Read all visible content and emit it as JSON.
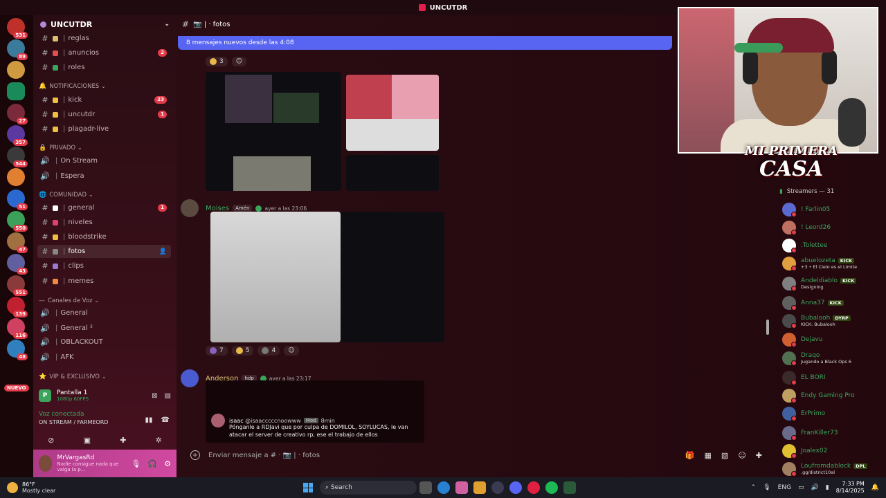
{
  "window": {
    "title": "UNCUTDR"
  },
  "rail": {
    "servers": [
      {
        "badge": "531",
        "color": "#c0302a"
      },
      {
        "badge": "89",
        "color": "#3a7a9a"
      },
      {
        "badge": "",
        "color": "#d09a40"
      },
      {
        "badge": "",
        "color": "#1a8a5a"
      },
      {
        "badge": "27",
        "color": "#7a2a3a"
      },
      {
        "badge": "357",
        "color": "#5a3aa0"
      },
      {
        "badge": "544",
        "color": "#3a3a3a"
      },
      {
        "badge": "",
        "color": "#e08030"
      },
      {
        "badge": "51",
        "color": "#2a6ad0"
      },
      {
        "badge": "550",
        "color": "#3aa05a"
      },
      {
        "badge": "47",
        "color": "#a07040"
      },
      {
        "badge": "43",
        "color": "#6060a0"
      },
      {
        "badge": "551",
        "color": "#8a3a3a"
      },
      {
        "badge": "139",
        "color": "#c02030"
      },
      {
        "badge": "116",
        "color": "#d04060"
      },
      {
        "badge": "48",
        "color": "#3080c0"
      }
    ],
    "nuevo": "NUEVO"
  },
  "sidebar": {
    "server_name": "UNCUTDR",
    "channels": [
      {
        "name": "reglas",
        "type": "text",
        "pip": "#d8c070",
        "count": ""
      },
      {
        "name": "anuncios",
        "type": "text",
        "pip": "#e05050",
        "count": "2"
      },
      {
        "name": "roles",
        "type": "text",
        "pip": "#3ba55c",
        "count": ""
      },
      {
        "name": "kick",
        "type": "text",
        "pip": "#f0c040",
        "count": "23"
      },
      {
        "name": "uncutdr",
        "type": "text",
        "pip": "#f0c040",
        "count": "1"
      },
      {
        "name": "plagadr-live",
        "type": "text",
        "pip": "#f0c040",
        "count": ""
      },
      {
        "name": "On Stream",
        "type": "voice",
        "pip": "",
        "count": ""
      },
      {
        "name": "Espera",
        "type": "voice",
        "pip": "",
        "count": ""
      },
      {
        "name": "general",
        "type": "text",
        "pip": "#ffffff",
        "count": "1"
      },
      {
        "name": "niveles",
        "type": "text",
        "pip": "#e04070",
        "count": ""
      },
      {
        "name": "bloodstrike",
        "type": "text",
        "pip": "#f0c040",
        "count": ""
      },
      {
        "name": "fotos",
        "type": "text",
        "pip": "#888888",
        "count": "",
        "active": true
      },
      {
        "name": "clips",
        "type": "text",
        "pip": "#9a7ad0",
        "count": ""
      },
      {
        "name": "memes",
        "type": "text",
        "pip": "#f08a40",
        "count": ""
      },
      {
        "name": "General",
        "type": "voice",
        "pip": "",
        "count": ""
      },
      {
        "name": "General ²",
        "type": "voice",
        "pip": "",
        "count": ""
      },
      {
        "name": "OBLACKOUT",
        "type": "voice",
        "pip": "",
        "count": ""
      },
      {
        "name": "AFK",
        "type": "voice",
        "pip": "",
        "count": ""
      }
    ],
    "categories": {
      "notificaciones": "NOTIFICACIONES",
      "privado": "PRIVADO",
      "comunidad": "COMUNIDAD",
      "canales_voz": "Canales de Voz",
      "vip": "VIP & EXCLUSIVO"
    },
    "stream_panel": {
      "title": "Pantalla 1",
      "quality": "1080p 60FPS"
    },
    "voice": {
      "status": "Voz conectada",
      "channel": "ON STREAM / FARMEORD"
    },
    "user": {
      "name": "MrVargasRd",
      "status": "Nadie consigue nada que valga la p..."
    }
  },
  "main": {
    "channel_name": "fotos",
    "new_messages": "8 mensajes nuevos desde las 4:08",
    "reactions_top": [
      {
        "count": "3"
      }
    ],
    "messages": [
      {
        "author": "Moises",
        "tag": "Amén",
        "time": "ayer a las 23:06",
        "color": "#3ba55c"
      },
      {
        "author": "Anderson",
        "tag": "hdp",
        "time": "ayer a las 23:17",
        "color": "#e0c070"
      }
    ],
    "reactions_mid": [
      {
        "count": "7"
      },
      {
        "count": "5"
      },
      {
        "count": "4"
      }
    ],
    "reply": {
      "user": "isaac",
      "handle": "@isaacccccnoowww",
      "role": "Mod",
      "time": "8min",
      "text": "Pónganle a RDJavi que por culpa de DOMILOL, SOYLUCAS, le van atacar el server de creativo rp, ese el trabajo de ellos"
    },
    "composer_placeholder": "Enviar mensaje a # · 📷 | · fotos"
  },
  "overlay": {
    "line1": "MI PRIMERA",
    "line2": "CASA"
  },
  "members": {
    "header": "Streamers — 31",
    "list": [
      {
        "name": "! Farlin05",
        "sub": "",
        "badge": "",
        "color": "#5a6ad0"
      },
      {
        "name": "! Leord26",
        "sub": "",
        "badge": "",
        "color": "#c07060"
      },
      {
        "name": ".Tolettee",
        "sub": "",
        "badge": "",
        "color": "#ffffff"
      },
      {
        "name": "abuelozeta",
        "sub": "+3 • El Cielo es el Límite",
        "badge": "KICK",
        "color": "#e0a040"
      },
      {
        "name": "Andeldiablo",
        "sub": "Designing",
        "badge": "KICK",
        "color": "#808080"
      },
      {
        "name": "Anna37",
        "sub": "",
        "badge": "KICK",
        "color": "#606060"
      },
      {
        "name": "Bubalooh",
        "sub": "KICK: Bubalooh",
        "badge": "DYRP",
        "color": "#4a4a4a"
      },
      {
        "name": "Dejavu",
        "sub": "",
        "badge": "",
        "color": "#d06030"
      },
      {
        "name": "Draqo",
        "sub": "Jugando a Black Ops 6",
        "badge": "",
        "color": "#507050"
      },
      {
        "name": "EL BORI",
        "sub": "",
        "badge": "",
        "color": "#3a2a2a"
      },
      {
        "name": "Endy Gaming Pro",
        "sub": "",
        "badge": "",
        "color": "#c0a060"
      },
      {
        "name": "ErPrimo",
        "sub": "",
        "badge": "",
        "color": "#4060a0"
      },
      {
        "name": "FranKiller73",
        "sub": "",
        "badge": "",
        "color": "#6a6a8a"
      },
      {
        "name": "Joalex02",
        "sub": "",
        "badge": "",
        "color": "#e0c030"
      },
      {
        "name": "Loufromdablock",
        "sub": ".gg/district10al",
        "badge": "DPL",
        "color": "#a08060"
      }
    ]
  },
  "taskbar": {
    "weather_temp": "86°F",
    "weather_desc": "Mostly clear",
    "search": "Search",
    "lang": "ENG",
    "time": "7:33 PM",
    "date": "8/14/2025"
  }
}
